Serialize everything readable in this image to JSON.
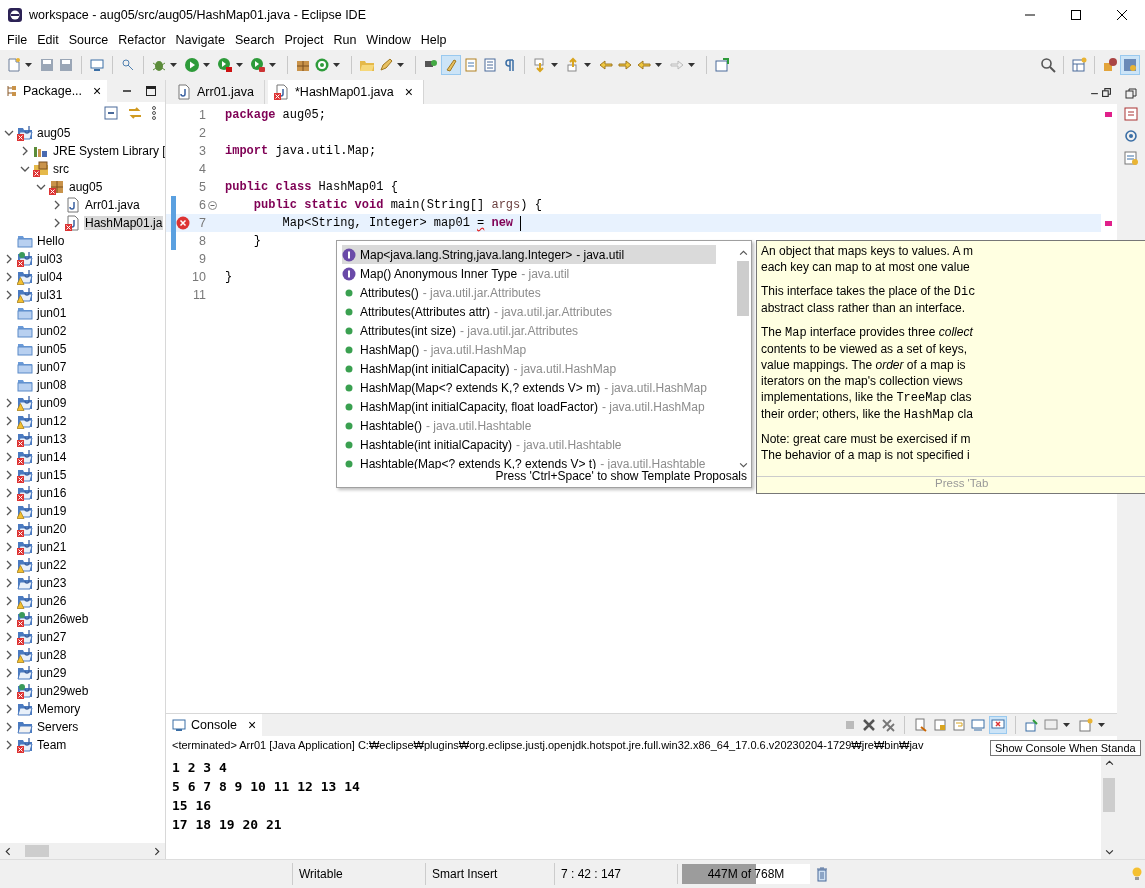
{
  "window": {
    "title": "workspace - aug05/src/aug05/HashMap01.java - Eclipse IDE"
  },
  "menu": [
    "File",
    "Edit",
    "Source",
    "Refactor",
    "Navigate",
    "Search",
    "Project",
    "Run",
    "Window",
    "Help"
  ],
  "package_explorer": {
    "tab_label": "Package...",
    "close": "×",
    "tree": [
      {
        "label": "aug05",
        "kind": "project",
        "error": true,
        "warning": false,
        "expanded": true,
        "selected": false,
        "children": [
          {
            "label": "JRE System Library [",
            "kind": "library",
            "error": false,
            "warning": false,
            "expanded": false,
            "selected": false
          },
          {
            "label": "src",
            "kind": "source-folder",
            "error": true,
            "warning": false,
            "expanded": true,
            "selected": false,
            "children": [
              {
                "label": "aug05",
                "kind": "package",
                "error": true,
                "warning": false,
                "expanded": true,
                "selected": false,
                "children": [
                  {
                    "label": "Arr01.java",
                    "kind": "java-file",
                    "error": false,
                    "warning": false,
                    "expanded": false,
                    "selected": false
                  },
                  {
                    "label": "HashMap01.ja",
                    "kind": "java-file",
                    "error": true,
                    "warning": false,
                    "expanded": false,
                    "selected": true
                  }
                ]
              }
            ]
          }
        ]
      },
      {
        "label": "Hello",
        "kind": "closed",
        "error": false,
        "warning": false,
        "selected": false
      },
      {
        "label": "jul03",
        "kind": "web-project",
        "error": true,
        "warning": false,
        "expanded": false,
        "selected": false
      },
      {
        "label": "jul04",
        "kind": "project",
        "error": false,
        "warning": true,
        "expanded": false,
        "selected": false
      },
      {
        "label": "jul31",
        "kind": "project",
        "error": false,
        "warning": true,
        "expanded": false,
        "selected": false
      },
      {
        "label": "jun01",
        "kind": "closed",
        "error": false,
        "warning": false,
        "selected": false
      },
      {
        "label": "jun02",
        "kind": "closed",
        "error": false,
        "warning": false,
        "selected": false
      },
      {
        "label": "jun05",
        "kind": "closed",
        "error": false,
        "warning": false,
        "selected": false
      },
      {
        "label": "jun07",
        "kind": "closed",
        "error": false,
        "warning": false,
        "selected": false
      },
      {
        "label": "jun08",
        "kind": "closed",
        "error": false,
        "warning": false,
        "selected": false
      },
      {
        "label": "jun09",
        "kind": "project",
        "error": false,
        "warning": true,
        "expanded": false,
        "selected": false
      },
      {
        "label": "jun12",
        "kind": "project",
        "error": false,
        "warning": true,
        "expanded": false,
        "selected": false
      },
      {
        "label": "jun13",
        "kind": "project",
        "error": true,
        "warning": false,
        "expanded": false,
        "selected": false
      },
      {
        "label": "jun14",
        "kind": "project",
        "error": true,
        "warning": false,
        "expanded": false,
        "selected": false
      },
      {
        "label": "jun15",
        "kind": "project",
        "error": true,
        "warning": false,
        "expanded": false,
        "selected": false
      },
      {
        "label": "jun16",
        "kind": "project",
        "error": true,
        "warning": false,
        "expanded": false,
        "selected": false
      },
      {
        "label": "jun19",
        "kind": "project",
        "error": false,
        "warning": true,
        "expanded": false,
        "selected": false
      },
      {
        "label": "jun20",
        "kind": "project",
        "error": true,
        "warning": false,
        "expanded": false,
        "selected": false
      },
      {
        "label": "jun21",
        "kind": "project",
        "error": true,
        "warning": false,
        "expanded": false,
        "selected": false
      },
      {
        "label": "jun22",
        "kind": "project",
        "error": false,
        "warning": true,
        "expanded": false,
        "selected": false
      },
      {
        "label": "jun23",
        "kind": "project",
        "error": false,
        "warning": false,
        "expanded": false,
        "selected": false
      },
      {
        "label": "jun26",
        "kind": "project",
        "error": false,
        "warning": true,
        "expanded": false,
        "selected": false
      },
      {
        "label": "jun26web",
        "kind": "web-project",
        "error": true,
        "warning": false,
        "expanded": false,
        "selected": false
      },
      {
        "label": "jun27",
        "kind": "project",
        "error": true,
        "warning": false,
        "expanded": false,
        "selected": false
      },
      {
        "label": "jun28",
        "kind": "project",
        "error": false,
        "warning": true,
        "expanded": false,
        "selected": false
      },
      {
        "label": "jun29",
        "kind": "project",
        "error": false,
        "warning": false,
        "expanded": false,
        "selected": false
      },
      {
        "label": "jun29web",
        "kind": "web-project",
        "error": true,
        "warning": false,
        "expanded": false,
        "selected": false
      },
      {
        "label": "Memory",
        "kind": "project",
        "error": false,
        "warning": false,
        "expanded": false,
        "selected": false
      },
      {
        "label": "Servers",
        "kind": "folder",
        "error": false,
        "warning": false,
        "expanded": false,
        "selected": false
      },
      {
        "label": "Team",
        "kind": "project",
        "error": true,
        "warning": false,
        "expanded": false,
        "selected": false
      }
    ]
  },
  "editor": {
    "tabs": [
      {
        "label": "Arr01.java",
        "selected": false,
        "error": false
      },
      {
        "label": "*HashMap01.java",
        "selected": true,
        "error": true,
        "close": "×"
      }
    ],
    "lines": [
      {
        "number": "1",
        "changed": false,
        "error": false,
        "current": false,
        "caret": false,
        "fold": false,
        "segments": [
          {
            "text": "package",
            "kind": "keyword"
          },
          {
            "text": " aug05;",
            "kind": "plain"
          }
        ]
      },
      {
        "number": "2",
        "changed": false,
        "error": false,
        "current": false,
        "caret": false,
        "fold": false
      },
      {
        "number": "3",
        "changed": false,
        "error": false,
        "current": false,
        "caret": false,
        "fold": false,
        "segments": [
          {
            "text": "import",
            "kind": "keyword"
          },
          {
            "text": " java.util.Map;",
            "kind": "plain"
          }
        ]
      },
      {
        "number": "4",
        "changed": false,
        "error": false,
        "current": false,
        "caret": false,
        "fold": false
      },
      {
        "number": "5",
        "changed": false,
        "error": false,
        "current": false,
        "caret": false,
        "fold": false,
        "segments": [
          {
            "text": "public class",
            "kind": "keyword"
          },
          {
            "text": " HashMap01 {",
            "kind": "plain"
          }
        ]
      },
      {
        "number": "6",
        "changed": true,
        "error": false,
        "current": false,
        "caret": false,
        "fold": true,
        "segments": [
          {
            "text": "    public static void",
            "kind": "keyword"
          },
          {
            "text": " main(String[] ",
            "kind": "plain"
          },
          {
            "text": "args",
            "kind": "param"
          },
          {
            "text": ") {",
            "kind": "plain"
          }
        ]
      },
      {
        "number": "7",
        "changed": true,
        "error": true,
        "current": true,
        "caret": true,
        "fold": false,
        "segments": [
          {
            "text": "        Map<String, Integer> map01 ",
            "kind": "plain"
          },
          {
            "text": "=",
            "kind": "error"
          },
          {
            "text": " new",
            "kind": "keyword"
          }
        ]
      },
      {
        "number": "8",
        "changed": true,
        "error": false,
        "current": false,
        "caret": false,
        "fold": false,
        "segments": [
          {
            "text": "    }",
            "kind": "plain"
          }
        ]
      },
      {
        "number": "9",
        "changed": false,
        "error": false,
        "current": false,
        "caret": false,
        "fold": false
      },
      {
        "number": "10",
        "changed": false,
        "error": false,
        "current": false,
        "caret": false,
        "fold": false,
        "segments": [
          {
            "text": "}",
            "kind": "plain"
          }
        ]
      },
      {
        "number": "11",
        "changed": false,
        "error": false,
        "current": false,
        "caret": false,
        "fold": false
      }
    ]
  },
  "completion": {
    "items": [
      {
        "kind": "interface",
        "label": "Map<java.lang.String,java.lang.Integer>",
        "detail": " - java.util",
        "selected": true
      },
      {
        "kind": "interface",
        "label": "Map()  Anonymous Inner Type",
        "detail": " - java.util",
        "selected": false
      },
      {
        "kind": "constructor",
        "label": "Attributes()",
        "detail": " - java.util.jar.Attributes",
        "selected": false
      },
      {
        "kind": "constructor",
        "label": "Attributes(Attributes attr)",
        "detail": " - java.util.jar.Attributes",
        "selected": false
      },
      {
        "kind": "constructor",
        "label": "Attributes(int size)",
        "detail": " - java.util.jar.Attributes",
        "selected": false
      },
      {
        "kind": "constructor",
        "label": "HashMap()",
        "detail": " - java.util.HashMap",
        "selected": false
      },
      {
        "kind": "constructor",
        "label": "HashMap(int initialCapacity)",
        "detail": " - java.util.HashMap",
        "selected": false
      },
      {
        "kind": "constructor",
        "label": "HashMap(Map<? extends K,? extends V> m)",
        "detail": " - java.util.HashMap",
        "selected": false
      },
      {
        "kind": "constructor",
        "label": "HashMap(int initialCapacity, float loadFactor)",
        "detail": " - java.util.HashMap",
        "selected": false
      },
      {
        "kind": "constructor",
        "label": "Hashtable()",
        "detail": " - java.util.Hashtable",
        "selected": false
      },
      {
        "kind": "constructor",
        "label": "Hashtable(int initialCapacity)",
        "detail": " - java.util.Hashtable",
        "selected": false
      },
      {
        "kind": "constructor",
        "label": "Hashtable(Map<? extends K,? extends V> t)",
        "detail": " - java.util.Hashtable",
        "selected": false
      }
    ],
    "footer": "Press 'Ctrl+Space' to show Template Proposals"
  },
  "documentation": {
    "paragraphs": [
      [
        [
          {
            "text": "An object that maps keys to values. A m",
            "kind": "plain"
          }
        ],
        [
          {
            "text": "each key can map to at most one value",
            "kind": "plain"
          }
        ]
      ],
      [
        [
          {
            "text": "This interface takes the place of the ",
            "kind": "plain"
          },
          {
            "text": "Dic",
            "kind": "code"
          }
        ],
        [
          {
            "text": "abstract class rather than an interface.",
            "kind": "plain"
          }
        ]
      ],
      [
        [
          {
            "text": "The ",
            "kind": "plain"
          },
          {
            "text": "Map",
            "kind": "code"
          },
          {
            "text": " interface provides three ",
            "kind": "plain"
          },
          {
            "text": "collect",
            "kind": "italic"
          }
        ],
        [
          {
            "text": "contents to be viewed as a set of keys,",
            "kind": "plain"
          }
        ],
        [
          {
            "text": "value mappings. The ",
            "kind": "plain"
          },
          {
            "text": "order",
            "kind": "italic"
          },
          {
            "text": " of a map is",
            "kind": "plain"
          }
        ],
        [
          {
            "text": "iterators on the map's collection views",
            "kind": "plain"
          }
        ],
        [
          {
            "text": "implementations, like the ",
            "kind": "plain"
          },
          {
            "text": "TreeMap",
            "kind": "code"
          },
          {
            "text": " clas",
            "kind": "plain"
          }
        ],
        [
          {
            "text": "their order; others, like the ",
            "kind": "plain"
          },
          {
            "text": "HashMap",
            "kind": "code"
          },
          {
            "text": " cla",
            "kind": "plain"
          }
        ]
      ],
      [
        [
          {
            "text": "Note: great care must be exercised if m",
            "kind": "plain"
          }
        ],
        [
          {
            "text": "The behavior of a map is not specified i",
            "kind": "plain"
          }
        ]
      ]
    ],
    "footer": "Press 'Tab"
  },
  "console": {
    "tab_label": "Console",
    "close": "×",
    "process": "<terminated> Arr01 [Java Application] C:₩eclipse₩plugins₩org.eclipse.justj.openjdk.hotspot.jre.full.win32.x86_64_17.0.6.v20230204-1729₩jre₩bin₩jav",
    "output": [
      "1 2 3 4",
      "5 6 7 8 9 10 11 12 13 14",
      "15 16",
      "17 18 19 20 21"
    ],
    "tooltip": "Show Console When Standa"
  },
  "status_bar": {
    "fields": [
      "Writable",
      "Smart Insert",
      "7 : 42 : 147"
    ],
    "heap": {
      "text": "447M of 768M",
      "level": 0.58
    }
  }
}
